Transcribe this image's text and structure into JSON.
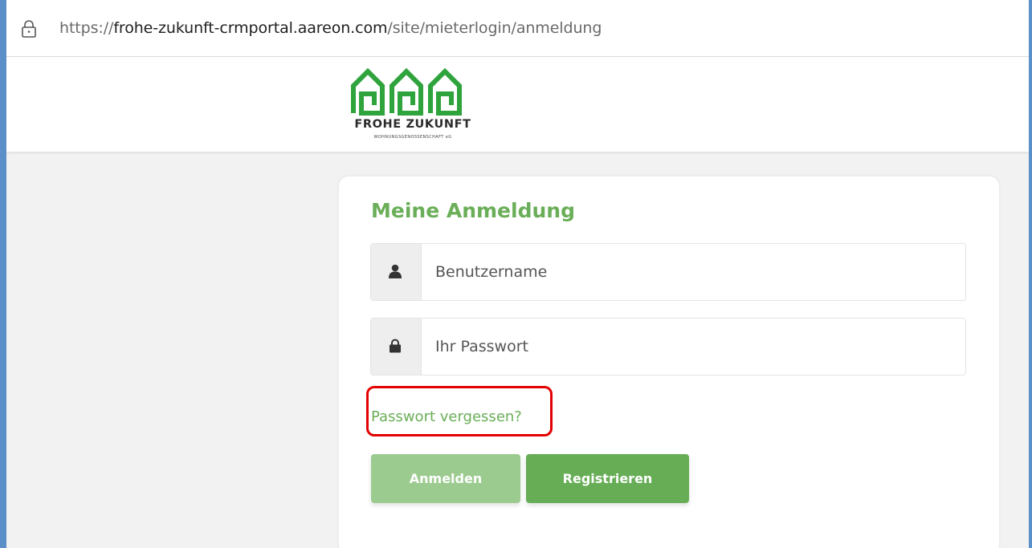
{
  "browser": {
    "url_scheme": "https://",
    "url_host": "frohe-zukunft-crmportal.aareon.com",
    "url_path": "/site/mieterlogin/anmeldung"
  },
  "logo": {
    "name": "FROHE ZUKUNFT",
    "subtitle": "WOHNUNGSGENOSSENSCHAFT eG",
    "color": "#2fa33c"
  },
  "login": {
    "title": "Meine Anmeldung",
    "username_placeholder": "Benutzername",
    "username_value": "",
    "password_placeholder": "Ihr Passwort",
    "password_value": "",
    "forgot_label": "Passwort vergessen?",
    "login_button": "Anmelden",
    "register_button": "Registrieren",
    "user_icon": "user-icon",
    "lock_icon": "lock-icon"
  },
  "colors": {
    "accent": "#6aae58",
    "highlight": "#e30000",
    "login_button": "#9ccb90",
    "register_button": "#67ad56"
  }
}
